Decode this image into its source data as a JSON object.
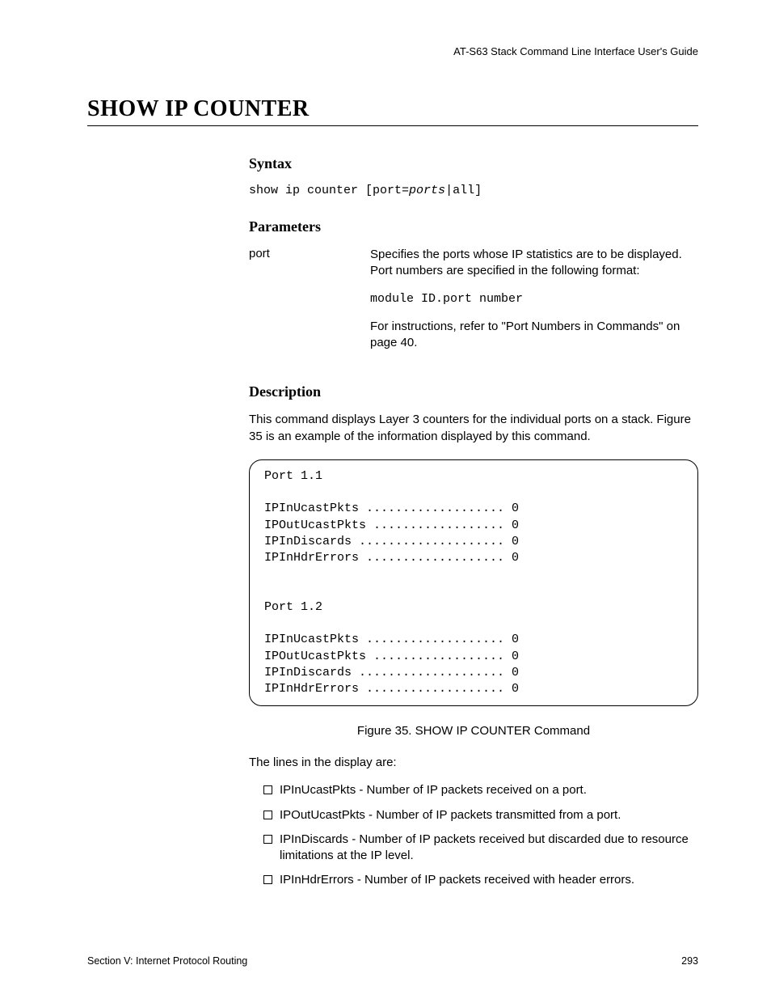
{
  "running_head": "AT-S63 Stack Command Line Interface User's Guide",
  "title": "SHOW IP COUNTER",
  "syntax": {
    "heading": "Syntax",
    "prefix": "show ip counter [port=",
    "italic": "ports",
    "suffix": "|all]"
  },
  "parameters": {
    "heading": "Parameters",
    "name": "port",
    "desc1": "Specifies the ports whose IP statistics are to be displayed. Port numbers are specified in the following format:",
    "code": "module ID.port number",
    "desc2": "For instructions, refer to \"Port Numbers in Commands\" on page 40."
  },
  "description": {
    "heading": "Description",
    "body": "This command displays Layer 3 counters for the individual ports on a stack. Figure 35 is an example of the information displayed by this command."
  },
  "figure": {
    "text": "Port 1.1\n\nIPInUcastPkts ................... 0\nIPOutUcastPkts .................. 0\nIPInDiscards .................... 0\nIPInHdrErrors ................... 0\n\n\nPort 1.2\n\nIPInUcastPkts ................... 0\nIPOutUcastPkts .................. 0\nIPInDiscards .................... 0\nIPInHdrErrors ................... 0",
    "caption": "Figure 35. SHOW IP COUNTER Command"
  },
  "lines_intro": "The lines in the display are:",
  "bullets": {
    "b0": "IPInUcastPkts - Number of IP packets received on a port.",
    "b1": "IPOutUcastPkts - Number of IP packets transmitted from a port.",
    "b2": "IPInDiscards - Number of IP packets received but discarded due to resource limitations at the IP level.",
    "b3": "IPInHdrErrors - Number of IP packets received with header errors."
  },
  "footer": {
    "left": "Section V: Internet Protocol Routing",
    "right": "293"
  }
}
